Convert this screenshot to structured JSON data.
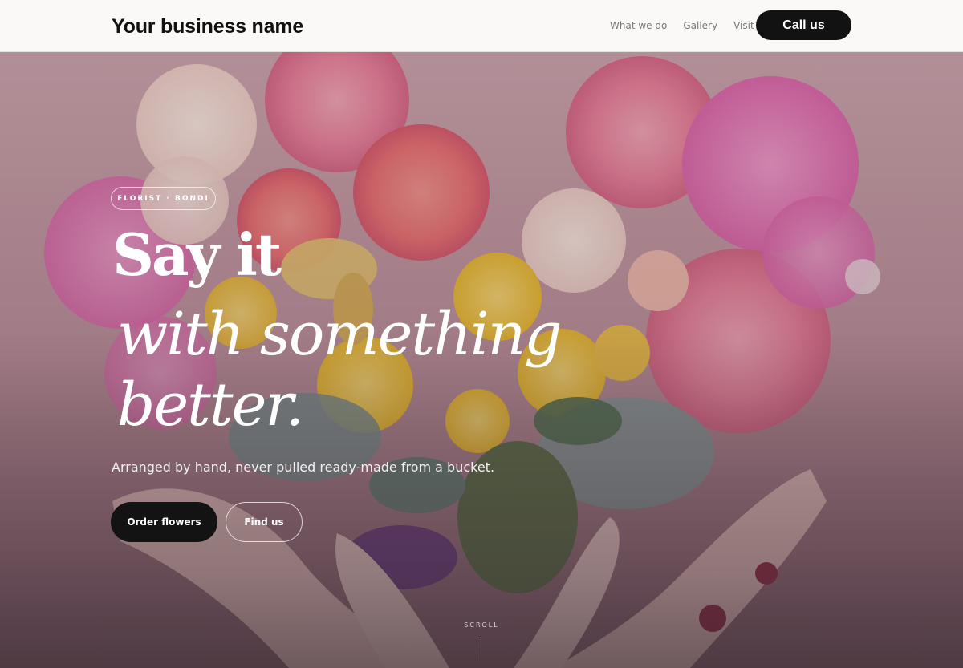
{
  "header": {
    "brand": "Your business name",
    "nav": [
      {
        "label": "What we do"
      },
      {
        "label": "Gallery"
      },
      {
        "label": "Visit"
      }
    ],
    "cta_label": "Call us"
  },
  "hero": {
    "eyebrow": "FLORIST · BONDI",
    "headline_line1": "Say it",
    "headline_line2": "with something",
    "headline_line3": "better.",
    "subtitle": "Arranged by hand, never pulled ready-made from a bucket.",
    "primary_button": "Order flowers",
    "secondary_button": "Find us",
    "scroll_label": "SCROLL"
  },
  "colors": {
    "header_bg": "#faf9f7",
    "button_dark": "#121212",
    "text_light": "#ffffff"
  }
}
